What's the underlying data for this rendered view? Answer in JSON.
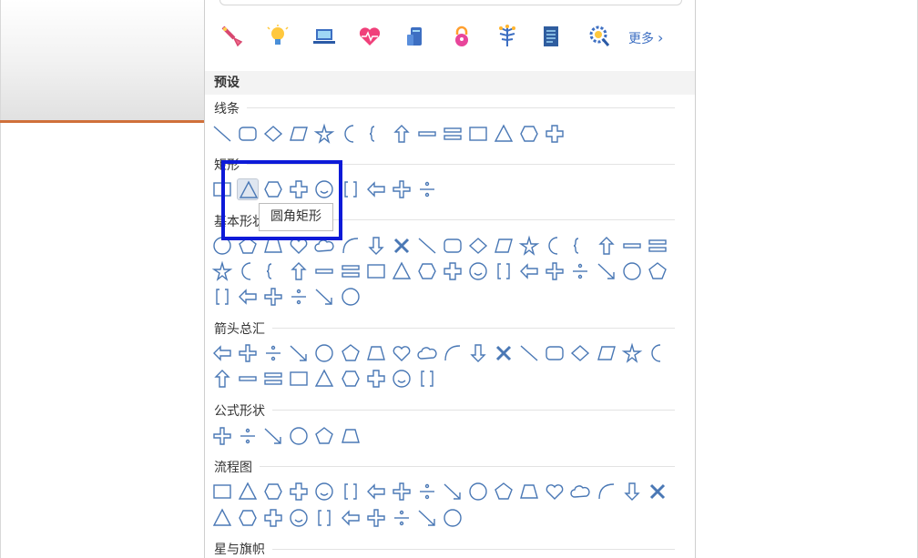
{
  "more_label": "更多",
  "preset_label": "预设",
  "tooltip_text": "圆角矩形",
  "stroke_color": "#4a78b5",
  "highlight_color": "#0d1ad8",
  "quick_icons": [
    "rocket-icon",
    "lightbulb-icon",
    "laptop-icon",
    "heart-pulse-icon",
    "server-icon",
    "lock-icon",
    "tree-icon",
    "document-icon",
    "gear-search-icon"
  ],
  "sections": [
    {
      "title": "线条",
      "shape_count": 14
    },
    {
      "title": "矩形",
      "shape_count": 9
    },
    {
      "title": "基本形状",
      "shape_count": 42
    },
    {
      "title": "箭头总汇",
      "shape_count": 27
    },
    {
      "title": "公式形状",
      "shape_count": 6
    },
    {
      "title": "流程图",
      "shape_count": 28
    },
    {
      "title": "星与旗帜",
      "shape_count": 0
    }
  ]
}
